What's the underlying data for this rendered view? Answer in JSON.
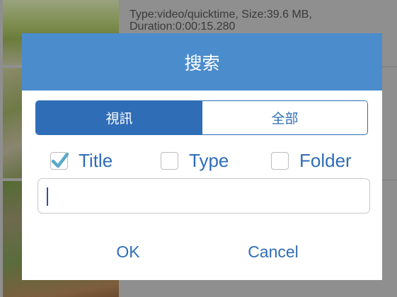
{
  "background": {
    "rows": [
      {
        "text": "Type:video/quicktime, Size:39.6 MB, Duration:0:00:15.280"
      }
    ]
  },
  "dialog": {
    "title": "搜索",
    "segments": [
      {
        "label": "視訊",
        "selected": true
      },
      {
        "label": "全部",
        "selected": false
      }
    ],
    "filters": [
      {
        "label": "Title",
        "checked": true
      },
      {
        "label": "Type",
        "checked": false
      },
      {
        "label": "Folder",
        "checked": false
      }
    ],
    "search": {
      "value": "",
      "placeholder": ""
    },
    "buttons": {
      "ok": "OK",
      "cancel": "Cancel"
    }
  },
  "colors": {
    "header": "#4b8ccd",
    "accent": "#2f6db7",
    "check": "#5aa9c9",
    "overlay": "#8f8f8f"
  }
}
